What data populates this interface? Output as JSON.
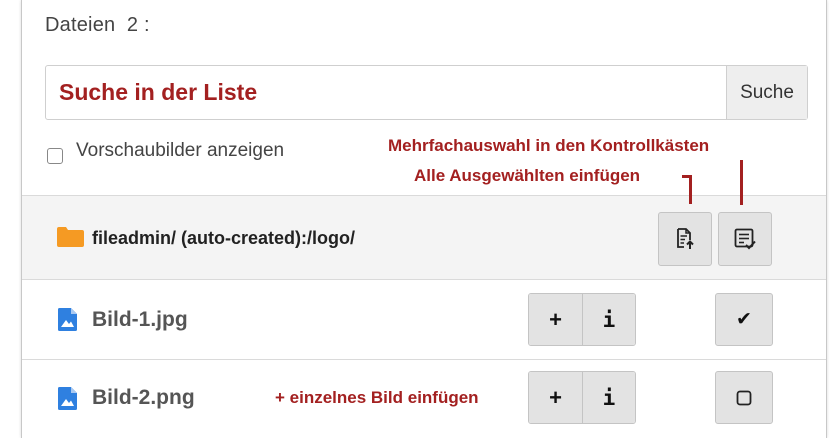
{
  "files_header": {
    "label": "Dateien",
    "count": "2 :"
  },
  "search": {
    "placeholder": "Suche in der Liste",
    "button_label": "Suche"
  },
  "thumbnails": {
    "label": "Vorschaubilder anzeigen",
    "checked": false
  },
  "annotations": {
    "multi_select": "Mehrfachauswahl in den Kontrollkästen",
    "insert_all": "Alle Ausgewählten einfügen",
    "insert_single": "+ einzelnes Bild einfügen",
    "color": "#a32020"
  },
  "folder": {
    "path": "fileadmin/ (auto-created):/logo/",
    "icon": "folder-icon",
    "color": "#f59a23"
  },
  "files": [
    {
      "name": "Bild-1.jpg",
      "icon": "image-file-icon",
      "selected": true
    },
    {
      "name": "Bild-2.png",
      "icon": "image-file-icon",
      "selected": false
    }
  ],
  "buttons": {
    "add_glyph": "+",
    "info_glyph": "i",
    "check_glyph": "✔"
  }
}
